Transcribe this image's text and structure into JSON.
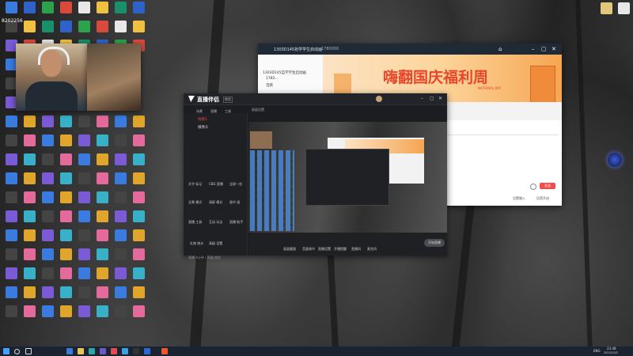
{
  "desktop": {
    "corner_label": "8202256",
    "top_icons": [
      {
        "label": "",
        "color": "#3a6fd8"
      },
      {
        "label": "",
        "color": "#2b9b3f"
      },
      {
        "label": "",
        "color": "#d9d9d9"
      },
      {
        "label": "",
        "color": "#3d87e0"
      },
      {
        "label": "",
        "color": "#e8e8e8"
      },
      {
        "label": "",
        "color": "#3f5d8a"
      },
      {
        "label": "",
        "color": "#e8e8e8"
      }
    ],
    "right_icons": [
      {
        "label": "",
        "color": "#e0c77a"
      },
      {
        "label": "",
        "color": "#e8e8e8"
      }
    ],
    "float_ball_label": ""
  },
  "webcam": {
    "label": "webcam-preview"
  },
  "browser": {
    "tab_title": "1303D145抢学学生启动画",
    "tab_subtitle": "1780000",
    "tree": [
      "1303D145自学学生启动画",
      "1782...",
      "活跃"
    ],
    "banner_text": "嗨翻国庆福利周",
    "banner_sub": "NATIONAL DAY",
    "input_hint": "",
    "send_label": "发送",
    "bottom_left": "设置输入",
    "bottom_right": "话筒开启"
  },
  "obs": {
    "app_name": "直播伴侣",
    "app_tag": "教程",
    "menu": [
      "场景",
      "直播",
      "工具"
    ],
    "top_hint": "帮助",
    "scene_label": "场景1",
    "source_item": "摄像头",
    "toolbar_hint": "画面设置",
    "left_tools": [
      {
        "label": "文字 标记"
      },
      {
        "label": "CBG 直播"
      },
      {
        "label": "全屏一览"
      },
      {
        "label": "全景 模式"
      },
      {
        "label": "清屏 模式"
      },
      {
        "label": "画中 画"
      },
      {
        "label": "直播 工具"
      },
      {
        "label": "互动 玩法"
      },
      {
        "label": "直播 助手"
      }
    ],
    "bottom_left": [
      {
        "label": "礼物 统计"
      },
      {
        "label": "高级 设置"
      }
    ],
    "bottom_tools": [
      {
        "label": "画面截图"
      },
      {
        "label": "音量调节"
      },
      {
        "label": "直播设置"
      },
      {
        "label": "开播提醒"
      },
      {
        "label": "直播间"
      },
      {
        "label": "麦克风"
      }
    ],
    "live_button": "开始直播",
    "status_text": "直播 4分钟 / 网速 良好",
    "status_right": "帧率 30"
  },
  "taskbar": {
    "time": "23:48",
    "date": "2023/10/2",
    "lang": "ENG"
  }
}
